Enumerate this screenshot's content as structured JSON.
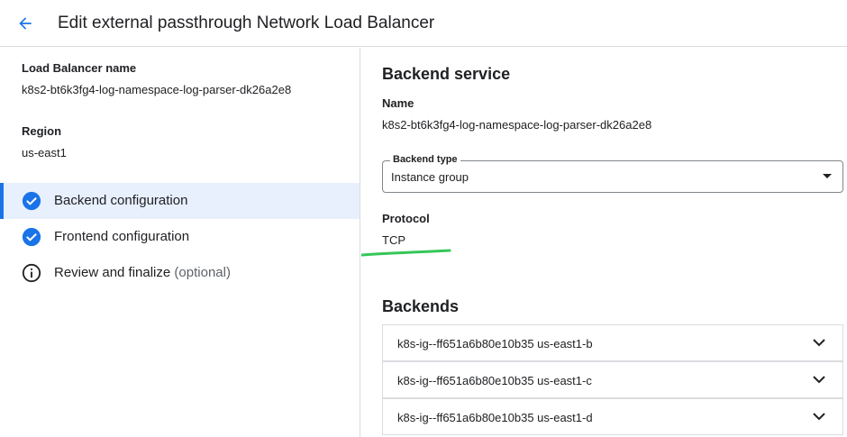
{
  "header": {
    "title": "Edit external passthrough Network Load Balancer",
    "back_icon": "arrow-back-icon"
  },
  "left": {
    "lb_name_label": "Load Balancer name",
    "lb_name_value": "k8s2-bt6k3fg4-log-namespace-log-parser-dk26a2e8",
    "region_label": "Region",
    "region_value": "us-east1",
    "steps": [
      {
        "label": "Backend configuration",
        "icon": "check-circle-icon",
        "state": "complete",
        "active": true
      },
      {
        "label": "Frontend configuration",
        "icon": "check-circle-icon",
        "state": "complete",
        "active": false
      },
      {
        "label": "Review and finalize",
        "suffix": "(optional)",
        "icon": "info-icon",
        "state": "pending",
        "active": false
      }
    ]
  },
  "right": {
    "section_title": "Backend service",
    "name_label": "Name",
    "name_value": "k8s2-bt6k3fg4-log-namespace-log-parser-dk26a2e8",
    "backend_type_label": "Backend type",
    "backend_type_value": "Instance group",
    "protocol_label": "Protocol",
    "protocol_value": "TCP",
    "backends_title": "Backends",
    "backends": [
      "k8s-ig--ff651a6b80e10b35 us-east1-b",
      "k8s-ig--ff651a6b80e10b35 us-east1-c",
      "k8s-ig--ff651a6b80e10b35 us-east1-d"
    ]
  },
  "colors": {
    "accent": "#1a73e8",
    "active_bg": "#e8f0fe",
    "annotation_green": "#34c759"
  }
}
